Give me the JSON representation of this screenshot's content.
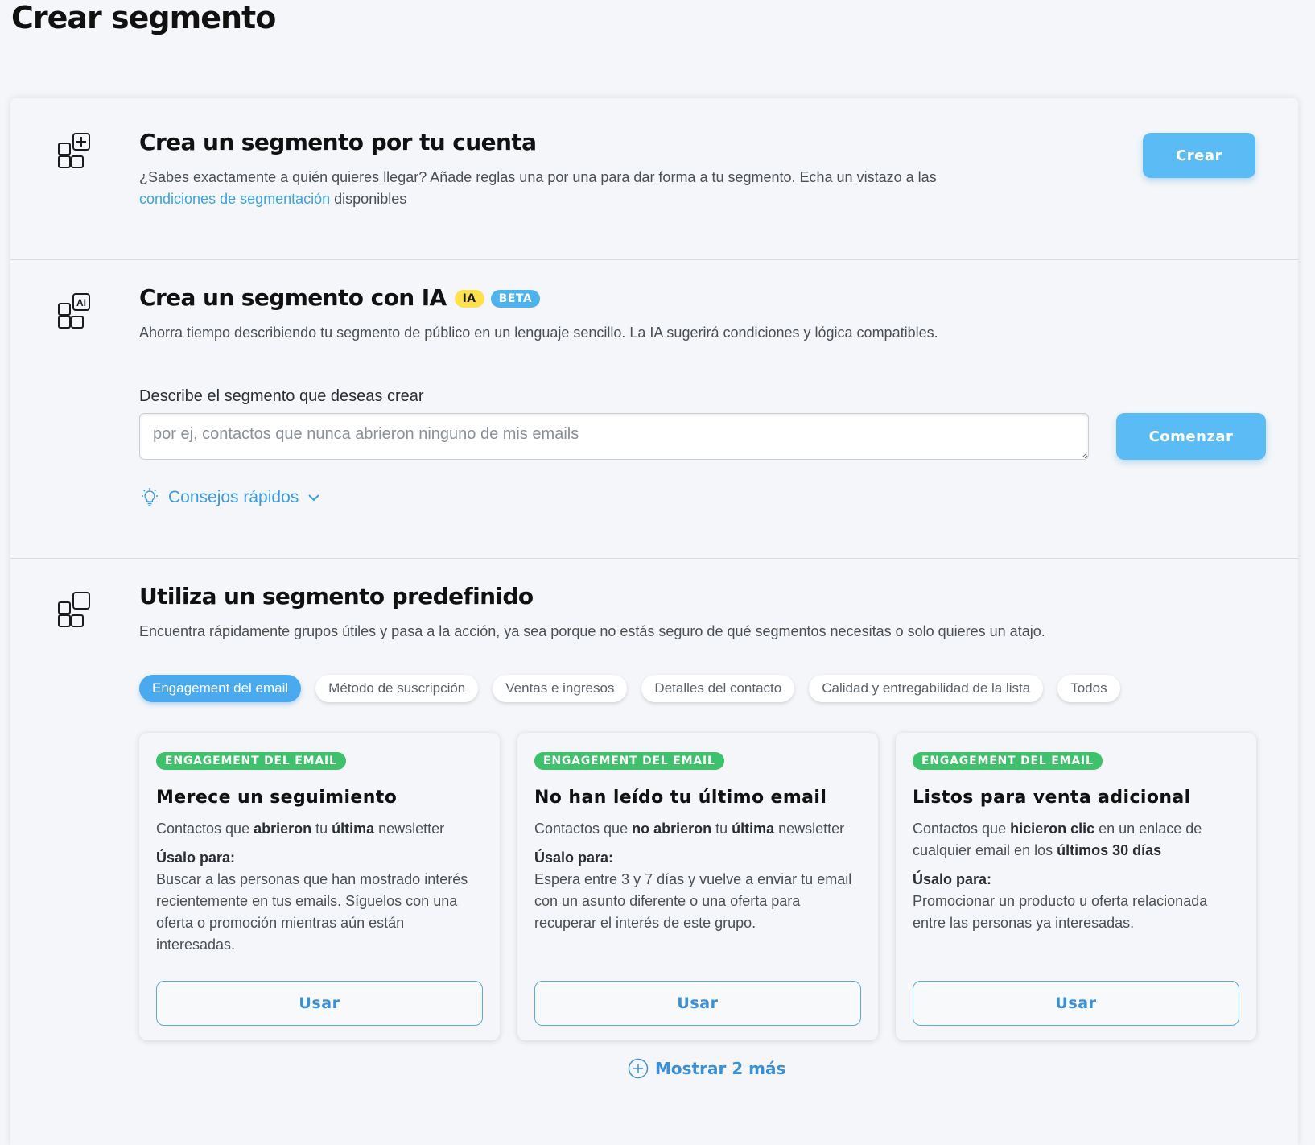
{
  "page": {
    "title": "Crear segmento"
  },
  "custom": {
    "title": "Crea un segmento por tu cuenta",
    "desc_text": "¿Sabes exactamente a quién quieres llegar? Añade reglas una por una para dar forma a tu segmento. Echa un vistazo a las ",
    "desc_link": "condiciones de segmentación",
    "desc_suffix": " disponibles",
    "button": "Crear"
  },
  "ai": {
    "title": "Crea un segmento con IA",
    "badge_ia": "IA",
    "badge_beta": "BETA",
    "desc": "Ahorra tiempo describiendo tu segmento de público en un lenguaje sencillo. La IA sugerirá condiciones y lógica compatibles.",
    "field_label": "Describe el segmento que deseas crear",
    "placeholder": "por ej, contactos que nunca abrieron ninguno de mis emails",
    "button": "Comenzar",
    "tips": "Consejos rápidos"
  },
  "predefined": {
    "title": "Utiliza un segmento predefinido",
    "desc": "Encuentra rápidamente grupos útiles y pasa a la acción, ya sea porque no estás seguro de qué segmentos necesitas o solo quieres un atajo.",
    "tabs": [
      {
        "label": "Engagement del email"
      },
      {
        "label": "Método de suscripción"
      },
      {
        "label": "Ventas e ingresos"
      },
      {
        "label": "Detalles del contacto"
      },
      {
        "label": "Calidad y entregabilidad de la lista"
      },
      {
        "label": "Todos"
      }
    ],
    "cards": [
      {
        "tag": "ENGAGEMENT DEL EMAIL",
        "title": "Merece un seguimiento",
        "summary": [
          {
            "t": "Contactos que "
          },
          {
            "t": "abrieron",
            "b": true
          },
          {
            "t": " tu "
          },
          {
            "t": "última",
            "b": true
          },
          {
            "t": " newsletter"
          }
        ],
        "use_label": "Úsalo para:",
        "use_text": "Buscar a las personas que han mostrado interés recientemente en tus emails. Síguelos con una oferta o promoción mientras aún están interesadas.",
        "button": "Usar"
      },
      {
        "tag": "ENGAGEMENT DEL EMAIL",
        "title": "No han leído tu último email",
        "summary": [
          {
            "t": "Contactos que "
          },
          {
            "t": "no abrieron",
            "b": true
          },
          {
            "t": " tu "
          },
          {
            "t": "última",
            "b": true
          },
          {
            "t": " newsletter"
          }
        ],
        "use_label": "Úsalo para:",
        "use_text": "Espera entre 3 y 7 días y vuelve a enviar tu email con un asunto diferente o una oferta para recuperar el interés de este grupo.",
        "button": "Usar"
      },
      {
        "tag": "ENGAGEMENT DEL EMAIL",
        "title": "Listos para venta adicional",
        "summary": [
          {
            "t": "Contactos que "
          },
          {
            "t": "hicieron clic",
            "b": true
          },
          {
            "t": " en un enlace de cualquier email en los "
          },
          {
            "t": "últimos 30 días",
            "b": true
          }
        ],
        "use_label": "Úsalo para:",
        "use_text": "Promocionar un producto u oferta relacionada entre las personas ya interesadas.",
        "button": "Usar"
      }
    ],
    "show_more": "Mostrar 2 más"
  }
}
